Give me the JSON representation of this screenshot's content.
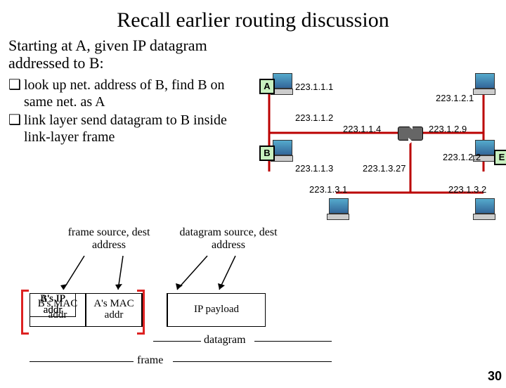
{
  "title": "Recall earlier routing discussion",
  "intro": "Starting at A, given IP datagram addressed to B:",
  "bullets": [
    "look up net. address of B, find B on same net. as A",
    "link layer send datagram to B inside link-layer frame"
  ],
  "bullet_glyph": "❑",
  "hosts": {
    "A": "A",
    "B": "B",
    "E": "E"
  },
  "ips": {
    "a": "223.1.1.1",
    "mid12": "223.1.1.2",
    "r_left": "223.1.1.4",
    "top21": "223.1.2.1",
    "r_right": "223.1.2.9",
    "b": "223.1.1.3",
    "r_bot": "223.1.3.27",
    "e": "223.1.2.2",
    "bl": "223.1.3.1",
    "br": "223.1.3.2"
  },
  "labels": {
    "frame_src": "frame source, dest address",
    "dgram_src": "datagram source, dest address"
  },
  "frame": {
    "bmac": "B's MAC addr",
    "amac": "A's MAC addr",
    "aip": "A's IP addr",
    "bip": "B's IP addr",
    "payload": "IP payload"
  },
  "dgram": "datagram",
  "framew": "frame",
  "pagenum": "30"
}
